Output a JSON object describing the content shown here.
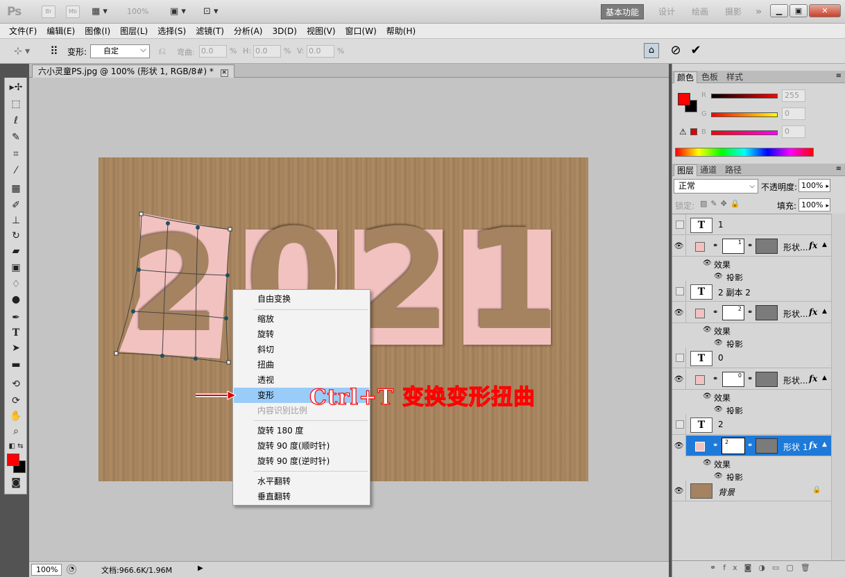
{
  "app": {
    "logo": "Ps",
    "bridge_label": "Br",
    "minibridge_label": "Mb",
    "zoom_label": "100%",
    "workspaces": [
      "基本功能",
      "设计",
      "绘画",
      "摄影"
    ],
    "more_label": "»"
  },
  "menu": [
    "文件(F)",
    "编辑(E)",
    "图像(I)",
    "图层(L)",
    "选择(S)",
    "滤镜(T)",
    "分析(A)",
    "3D(D)",
    "视图(V)",
    "窗口(W)",
    "帮助(H)"
  ],
  "options": {
    "transform_label": "变形:",
    "transform_value": "自定",
    "bend_label": "弯曲:",
    "bend_value": "0.0",
    "h_label": "H:",
    "h_value": "0.0",
    "v_label": "V:",
    "v_value": "0.0",
    "pct": "%"
  },
  "document": {
    "tab_title": "六小灵童PS.jpg @ 100% (形状 1, RGB/8#) *",
    "digits": [
      "2",
      "0",
      "2",
      "1"
    ]
  },
  "status": {
    "zoom": "100%",
    "doc_info": "文档:966.6K/1.96M"
  },
  "context_menu": {
    "free_transform": "自由变换",
    "scale": "缩放",
    "rotate": "旋转",
    "skew": "斜切",
    "distort": "扭曲",
    "perspective": "透视",
    "warp": "变形",
    "content_aware_scale": "内容识别比例",
    "rotate_180": "旋转 180 度",
    "rotate_90_cw": "旋转 90 度(顺时针)",
    "rotate_90_ccw": "旋转 90 度(逆时针)",
    "flip_h": "水平翻转",
    "flip_v": "垂直翻转"
  },
  "annotation": "Ctrl+T 变换变形扭曲",
  "color_panel": {
    "tabs": [
      "颜色",
      "色板",
      "样式"
    ],
    "r_label": "R",
    "r_value": "255",
    "g_label": "G",
    "g_value": "0",
    "b_label": "B",
    "b_value": "0",
    "fg_color": "#ff0000",
    "bg_color": "#000000"
  },
  "layers_panel": {
    "tabs": [
      "图层",
      "通道",
      "路径"
    ],
    "blend_mode": "正常",
    "opacity_label": "不透明度:",
    "opacity_value": "100%",
    "lock_label": "锁定:",
    "fill_label": "填充:",
    "fill_value": "100%",
    "effects_label": "效果",
    "drop_shadow_label": "投影",
    "layers": [
      {
        "name": "1",
        "type": "text"
      },
      {
        "name": "形状...",
        "type": "shape",
        "mask_text": "1"
      },
      {
        "name": "2 副本 2",
        "type": "text"
      },
      {
        "name": "形状...",
        "type": "shape",
        "mask_text": "2"
      },
      {
        "name": "0",
        "type": "text"
      },
      {
        "name": "形状...",
        "type": "shape",
        "mask_text": "0"
      },
      {
        "name": "2",
        "type": "text"
      },
      {
        "name": "形状 1",
        "type": "shape",
        "mask_text": "2",
        "selected": true
      },
      {
        "name": "背景",
        "type": "background"
      }
    ]
  }
}
